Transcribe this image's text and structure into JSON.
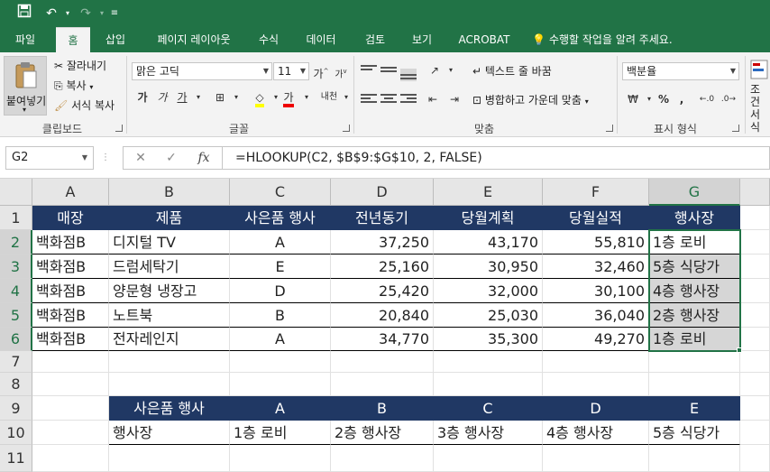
{
  "ribbon_tabs": [
    "파일",
    "홈",
    "삽입",
    "페이지 레이아웃",
    "수식",
    "데이터",
    "검토",
    "보기",
    "ACROBAT"
  ],
  "active_tab": "홈",
  "tell_me": "수행할 작업을 알려 주세요.",
  "clipboard": {
    "paste_label": "붙여넣기",
    "cut_label": "잘라내기",
    "copy_label": "복사",
    "format_painter_label": "서식 복사",
    "group_label": "클립보드"
  },
  "font": {
    "font_name": "맑은 고딕",
    "font_size": "11",
    "grow_label": "가",
    "shrink_label": "가",
    "bold_label": "가",
    "italic_label": "가",
    "underline_label": "가",
    "font_color_label": "가",
    "phonetic_label": "내천",
    "group_label": "글꼴"
  },
  "alignment": {
    "wrap_text_label": "텍스트 줄 바꿈",
    "merge_center_label": "병합하고 가운데 맞춤",
    "group_label": "맞춤"
  },
  "number": {
    "format_value": "백분율",
    "percent_label": "%",
    "comma_label": ",",
    "group_label": "표시 형식"
  },
  "styles_partial_label": "조건\n서식",
  "formula_bar": {
    "name_box": "G2",
    "formula": "=HLOOKUP(C2, $B$9:$G$10, 2, FALSE)",
    "cancel_glyph": "✕",
    "enter_glyph": "✓",
    "fx_glyph": "fx"
  },
  "columns": [
    "A",
    "B",
    "C",
    "D",
    "E",
    "F",
    "G"
  ],
  "rows": [
    "1",
    "2",
    "3",
    "4",
    "5",
    "6",
    "7",
    "8",
    "9",
    "10",
    "11"
  ],
  "table": {
    "headers": [
      "매장",
      "제품",
      "사은품 행사",
      "전년동기",
      "당월계획",
      "당월실적",
      "행사장"
    ],
    "rows": [
      [
        "백화점B",
        "디지털 TV",
        "A",
        "37,250",
        "43,170",
        "55,810",
        "1층 로비"
      ],
      [
        "백화점B",
        "드럼세탁기",
        "E",
        "25,160",
        "30,950",
        "32,460",
        "5층 식당가"
      ],
      [
        "백화점B",
        "양문형 냉장고",
        "D",
        "25,420",
        "32,000",
        "30,100",
        "4층 행사장"
      ],
      [
        "백화점B",
        "노트북",
        "B",
        "20,840",
        "25,030",
        "36,040",
        "2층 행사장"
      ],
      [
        "백화점B",
        "전자레인지",
        "A",
        "34,770",
        "35,300",
        "49,270",
        "1층 로비"
      ]
    ]
  },
  "lookup": {
    "header": [
      "사은품 행사",
      "A",
      "B",
      "C",
      "D",
      "E"
    ],
    "values": [
      "행사장",
      "1층 로비",
      "2층 행사장",
      "3층 행사장",
      "4층 행사장",
      "5층 식당가"
    ]
  }
}
